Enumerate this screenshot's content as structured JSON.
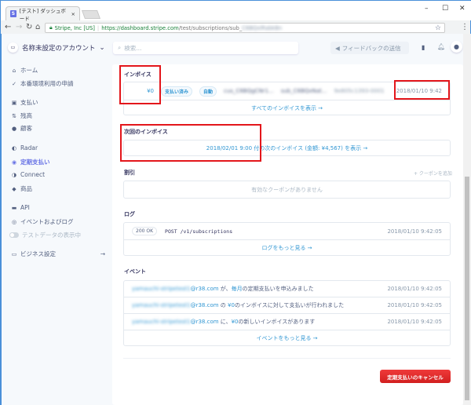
{
  "browser": {
    "tab_title": "[テスト] ダッシュボード",
    "site_identity": "Stripe, Inc [US]",
    "url_host": "https://dashboard.stripe.com",
    "url_path": "/test/subscriptions/sub_",
    "url_hidden": "C6BQxlRabkBn"
  },
  "header": {
    "account": "名称未設定のアカウント",
    "search_placeholder": "検索...",
    "feedback": "フィードバックの送信"
  },
  "sidebar": {
    "items": [
      {
        "label": "ホーム",
        "icon": "⌂"
      },
      {
        "label": "本番環境利用の申請",
        "icon": "✓"
      },
      {
        "label": "支払い",
        "icon": "▣"
      },
      {
        "label": "残高",
        "icon": "⇅"
      },
      {
        "label": "顧客",
        "icon": "●"
      },
      {
        "label": "Radar",
        "icon": "◐"
      },
      {
        "label": "定期支払い",
        "icon": "◉"
      },
      {
        "label": "Connect",
        "icon": "◑"
      },
      {
        "label": "商品",
        "icon": "◆"
      },
      {
        "label": "API",
        "icon": "▬"
      },
      {
        "label": "イベントおよびログ",
        "icon": "◎"
      },
      {
        "label": "テストデータの表示中",
        "icon": ""
      },
      {
        "label": "ビジネス設定",
        "icon": "▭"
      }
    ],
    "arrow": "→"
  },
  "invoices": {
    "title": "インボイス",
    "amount": "¥0",
    "status": "支払い済み",
    "billing": "自動",
    "customer": "cus_C6BQgCNr1...",
    "subscription": "sub_C6BQxNat...",
    "number": "9e805c1393-0001",
    "date": "2018/01/10 9:42",
    "view_all": "すべてのインボイスを表示 →"
  },
  "next_invoice": {
    "title": "次回のインボイス",
    "link": "2018/02/01 9:00 付の次のインボイス (金額: ¥4,567) を表示 →"
  },
  "discount": {
    "title": "割引",
    "add": "+ クーポンを追加",
    "empty": "有効なクーポンがありません"
  },
  "logs": {
    "title": "ログ",
    "status": "200 OK",
    "request": "POST /v1/subscriptions",
    "time": "2018/01/10 9:42:05",
    "more": "ログをもっと見る →"
  },
  "events": {
    "title": "イベント",
    "items": [
      {
        "email_hidden": "yamauchi-stripetest1",
        "email_domain": "@r38.com",
        "pre": " が、",
        "amount": "毎月",
        "text": "の定期支払いを申込みました",
        "time": "2018/01/10 9:42:05"
      },
      {
        "email_hidden": "yamauchi-stripetest1",
        "email_domain": "@r38.com",
        "pre": " の ",
        "amount": "¥0",
        "text": "のインボイスに対して支払いが行われました",
        "time": "2018/01/10 9:42:05"
      },
      {
        "email_hidden": "yamauchi-stripetest1",
        "email_domain": "@r38.com",
        "pre": " に、",
        "amount": "¥0",
        "text": "の新しいインボイスがあります",
        "time": "2018/01/10 9:42:05"
      }
    ],
    "more": "イベントをもっと見る →"
  },
  "cancel_button": "定期支払いのキャンセル"
}
